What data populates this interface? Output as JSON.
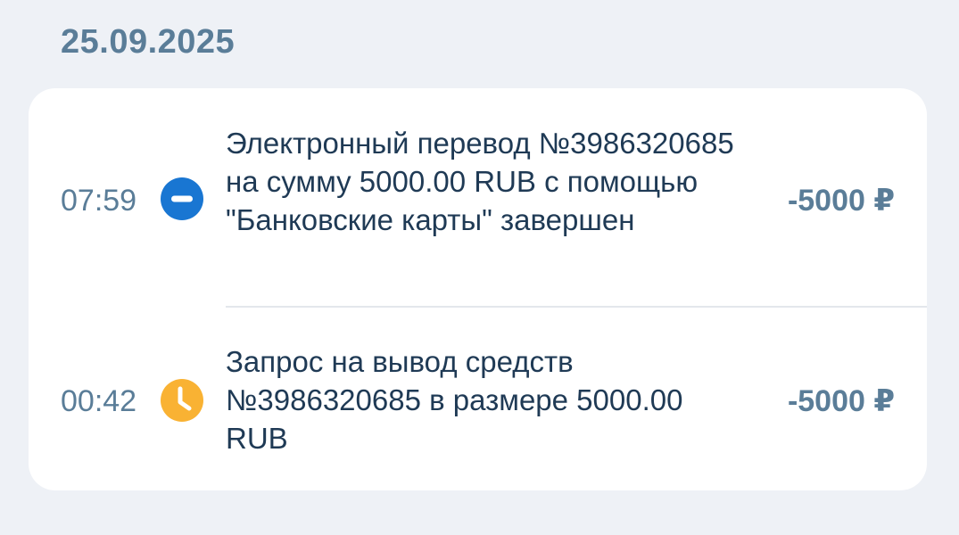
{
  "date": "25.09.2025",
  "transactions": [
    {
      "time": "07:59",
      "status_icon": "minus-circle-icon",
      "status_color": "#1976d2",
      "description": "Электронный перевод №3986320685 на сумму 5000.00 RUB с помощью \"Банковские карты\" завершен",
      "amount": "-5000 ₽"
    },
    {
      "time": "00:42",
      "status_icon": "clock-icon",
      "status_color": "#f9b233",
      "description": "Запрос на вывод средств №3986320685 в размере 5000.00 RUB",
      "amount": "-5000 ₽"
    }
  ]
}
